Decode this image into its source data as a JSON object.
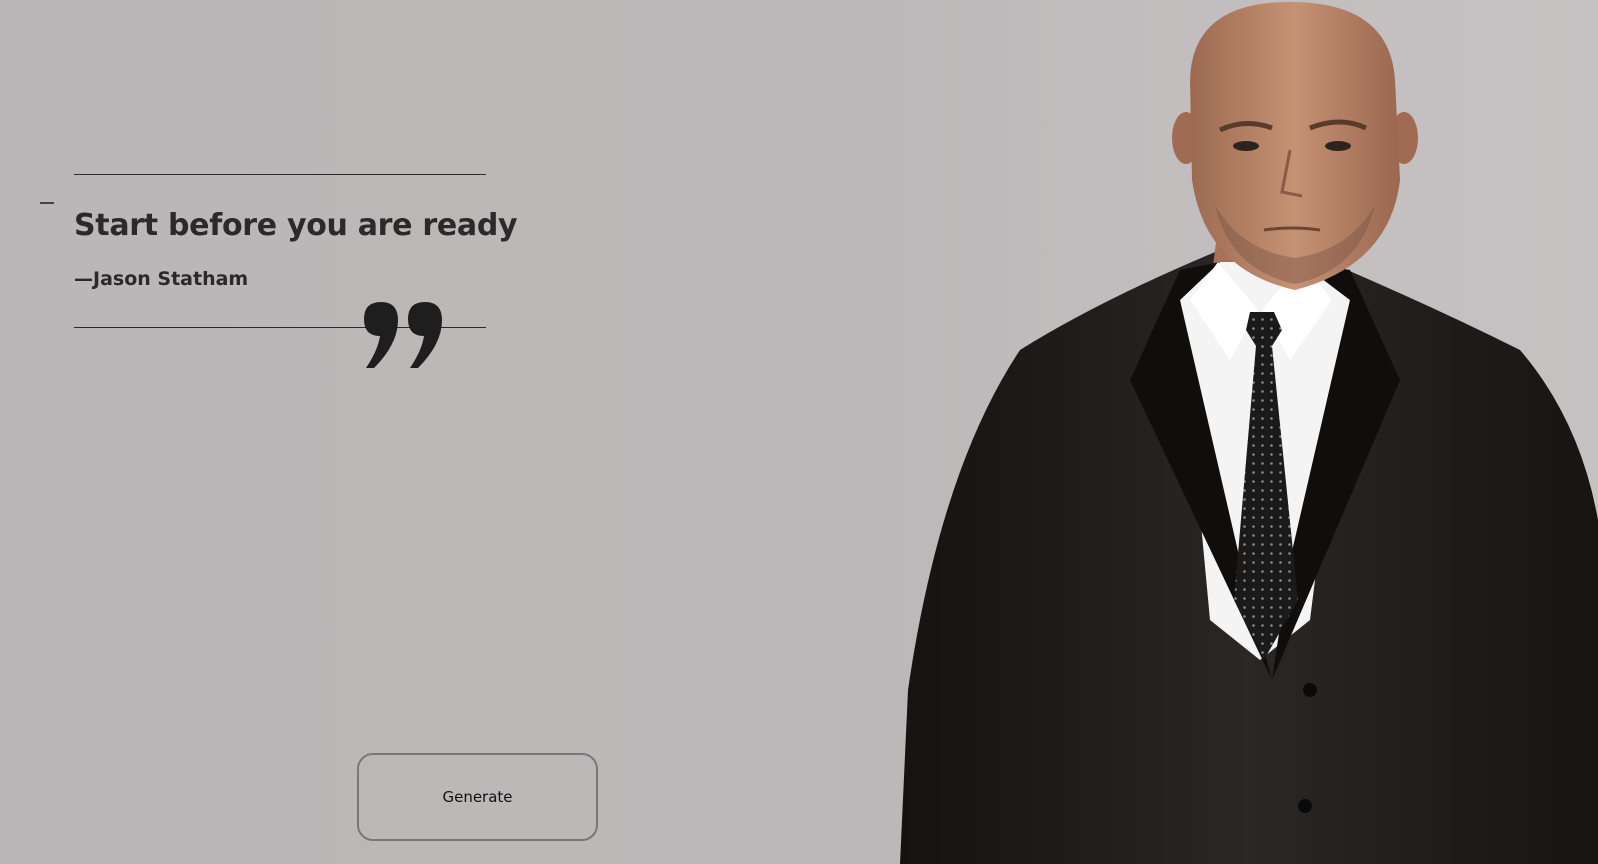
{
  "quote": {
    "text": "Start before you are ready",
    "author": "—Jason Statham"
  },
  "icons": {
    "quote_mark": "closing-quote-icon",
    "small_dash": "dash-icon"
  },
  "button": {
    "generate_label": "Generate"
  },
  "colors": {
    "background": "#bcb8b9",
    "text": "#2a2a2a",
    "suit": "#1c1a19",
    "shirt": "#f4f4f4",
    "skin": "#b98467",
    "button_border": "#7a7778"
  }
}
